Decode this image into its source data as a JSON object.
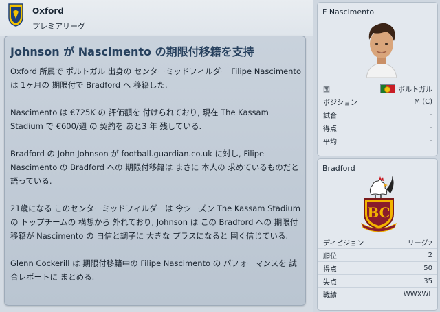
{
  "club": {
    "name": "Oxford",
    "league": "プレミアリーグ"
  },
  "news": {
    "title": "Johnson が Nascimento の期限付移籍を支持",
    "paragraphs": [
      "Oxford 所属で ポルトガル 出身の センターミッドフィルダー Filipe Nascimento は 1ヶ月の 期限付で Bradford へ 移籍した.",
      "Nascimento は €725K の 評価額を 付けられており, 現在 The Kassam Stadium で €600/週 の 契約を あと3 年 残している.",
      "Bradford の John Johnson が football.guardian.co.uk に対し, Filipe Nascimento の Bradford への 期限付移籍は まさに 本人の 求めているものだと 語っている.",
      "21歳になる このセンターミッドフィルダーは 今シーズン The Kassam Stadium の トップチームの 構想から 外れており, Johnson は この Bradford への 期限付移籍が Nascimento の 自信と調子に 大きな プラスになると 固く信じている.",
      "Glenn Cockerill は 期限付移籍中の Filipe Nascimento の パフォーマンスを 試合レポートに まとめる."
    ]
  },
  "player": {
    "name": "F Nascimento",
    "rows": [
      {
        "label": "国",
        "value": "ポルトガル",
        "flag": "portugal-flag"
      },
      {
        "label": "ポジション",
        "value": "M (C)"
      },
      {
        "label": "試合",
        "value": "-"
      },
      {
        "label": "得点",
        "value": "-"
      },
      {
        "label": "平均",
        "value": "-"
      }
    ]
  },
  "loan_club": {
    "name": "Bradford",
    "rows": [
      {
        "label": "ディビジョン",
        "value": "リーグ2"
      },
      {
        "label": "順位",
        "value": "2"
      },
      {
        "label": "得点",
        "value": "50"
      },
      {
        "label": "失点",
        "value": "35"
      },
      {
        "label": "戦績",
        "value": "WWXWL"
      }
    ]
  },
  "colors": {
    "title_blue": "#27415e",
    "panel_bg": "#c9d2dc",
    "side_card_bg": "#e3e8ee"
  }
}
